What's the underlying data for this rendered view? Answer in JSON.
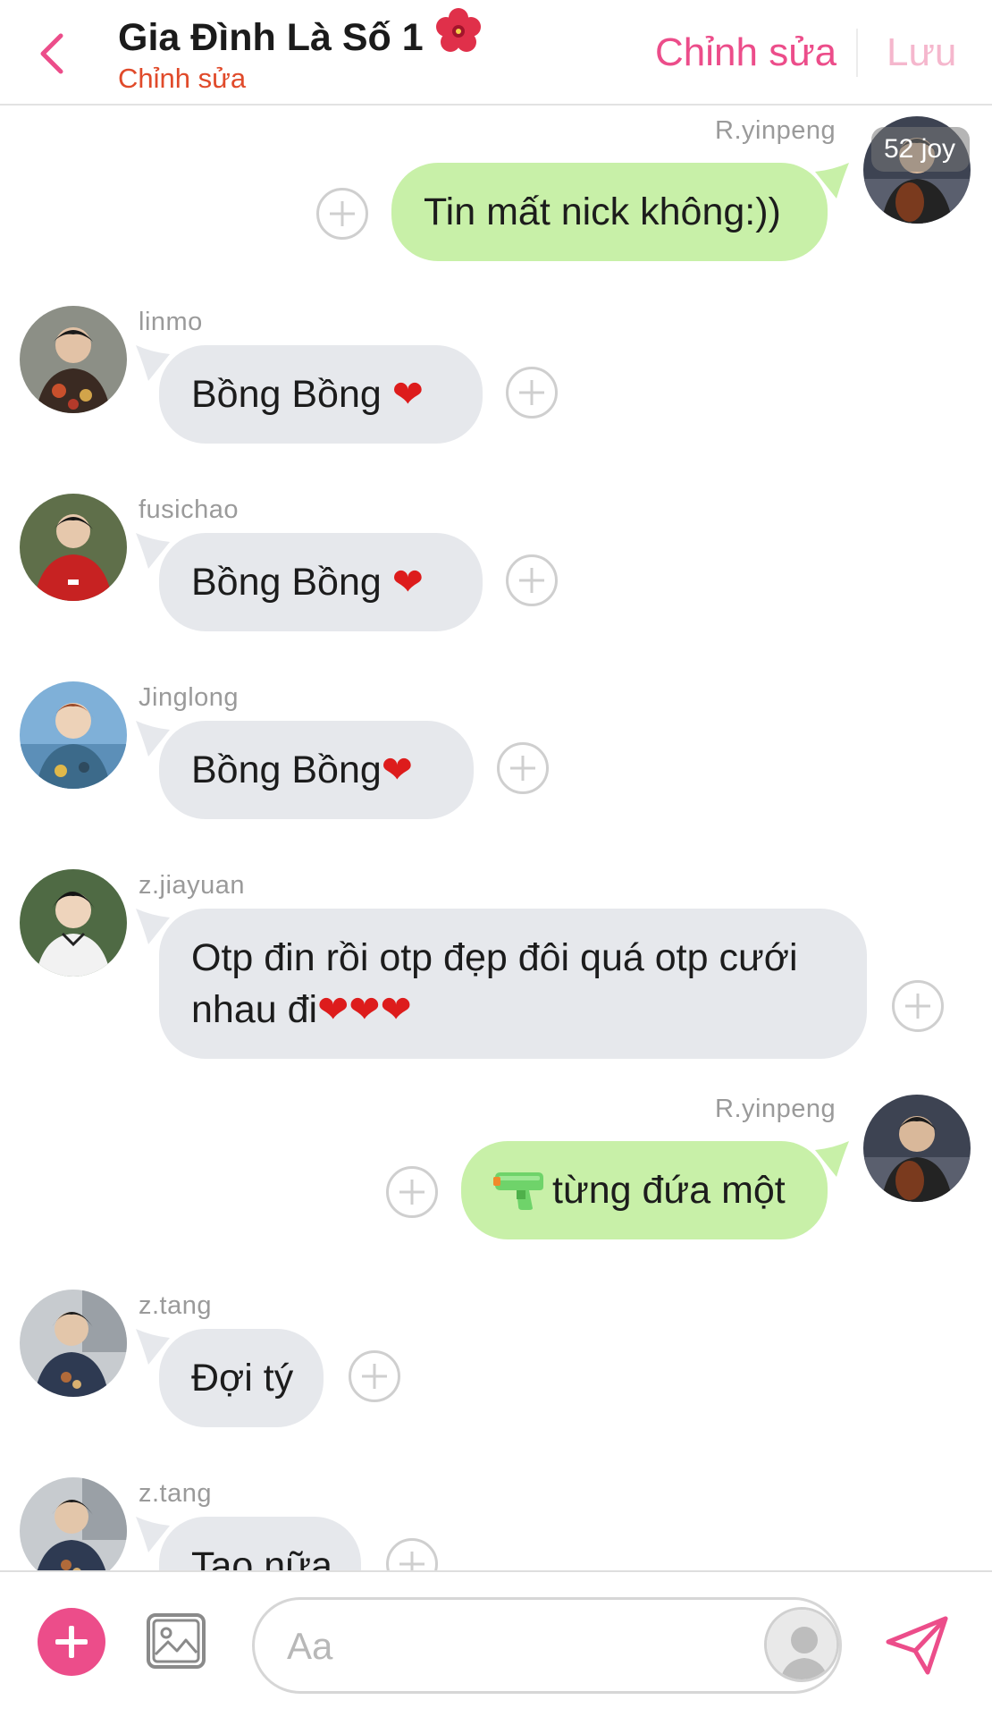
{
  "header": {
    "title": "Gia Đình Là Số 1",
    "title_icon": "hibiscus-flower-icon",
    "subtitle": "Chỉnh sửa",
    "edit_label": "Chỉnh sửa",
    "save_label": "Lưu",
    "accent_color": "#ec4d8a"
  },
  "messages": [
    {
      "sender": "R.yinpeng",
      "side": "out",
      "text": "Tin mất nick không:))",
      "badge": "52 joy"
    },
    {
      "sender": "linmo",
      "side": "in",
      "text": "Bồng Bồng ",
      "emoji": "❤"
    },
    {
      "sender": "fusichao",
      "side": "in",
      "text": "Bồng Bồng ",
      "emoji": "❤"
    },
    {
      "sender": "Jinglong",
      "side": "in",
      "text": "Bồng Bồng",
      "emoji": "❤"
    },
    {
      "sender": "z.jiayuan",
      "side": "in",
      "text_line1": "Otp đin rồi otp đẹp đôi quá otp cưới",
      "text_line2": "nhau đi",
      "emoji": "❤❤❤"
    },
    {
      "sender": "R.yinpeng",
      "side": "out",
      "emoji_icon": "water-pistol-icon",
      "text": "từng đứa một"
    },
    {
      "sender": "z.tang",
      "side": "in",
      "text": "Đợi tý"
    },
    {
      "sender": "z.tang",
      "side": "in",
      "text": "Tao nữa"
    }
  ],
  "composer": {
    "placeholder": "Aa",
    "value": ""
  }
}
